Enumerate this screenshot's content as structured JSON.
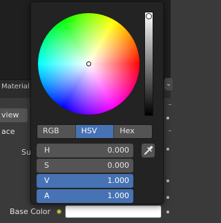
{
  "background": {
    "header_label": "Material",
    "left_buttons": [
      "view",
      "ace"
    ],
    "left_label": "Sur",
    "right_button_icon": "chevron-down-icon"
  },
  "base_color": {
    "label": "Base Color",
    "swatch_color": "#ffffff"
  },
  "picker": {
    "mode_tabs": [
      {
        "label": "RGB",
        "active": false
      },
      {
        "label": "HSV",
        "active": true
      },
      {
        "label": "Hex",
        "active": false
      }
    ],
    "fields": [
      {
        "label": "H",
        "value": "0.000",
        "active": false
      },
      {
        "label": "S",
        "value": "0.000",
        "active": false
      },
      {
        "label": "V",
        "value": "1.000",
        "active": true
      },
      {
        "label": "A",
        "value": "1.000",
        "active": true
      }
    ],
    "eyedropper_icon": "eyedropper-icon",
    "value_level": 1.0
  },
  "colors": {
    "accent": "#4772b3",
    "popup_bg": "#232323",
    "button_bg": "#545454"
  }
}
